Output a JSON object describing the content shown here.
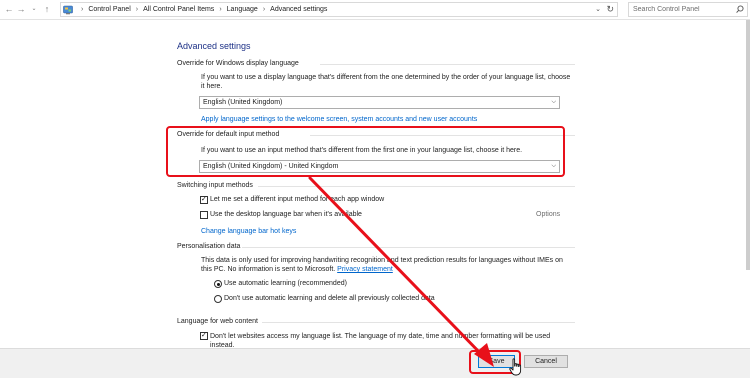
{
  "address_bar": {
    "back_icon": "back-arrow-icon",
    "forward_icon": "forward-arrow-icon",
    "recent_icon": "chevron-down-icon",
    "up_icon": "up-arrow-icon",
    "crumbs": [
      "Control Panel",
      "All Control Panel Items",
      "Language",
      "Advanced settings"
    ],
    "search_placeholder": "Search Control Panel"
  },
  "page": {
    "title": "Advanced settings",
    "display_language": {
      "heading": "Override for Windows display language",
      "desc_line1": "If you want to use a display language that's different from the one determined by the order of your language list, choose",
      "desc_line2": "it here.",
      "selected": "English (United Kingdom)",
      "link": "Apply language settings to the welcome screen, system accounts and new user accounts"
    },
    "input_method": {
      "heading": "Override for default input method",
      "desc": "If you want to use an input method that's different from the first one in your language list, choose it here.",
      "selected": "English (United Kingdom) - United Kingdom"
    },
    "switching": {
      "heading": "Switching input methods",
      "opt1": "Let me set a different input method for each app window",
      "opt1_checked": true,
      "opt2": "Use the desktop language bar when it's available",
      "opt2_checked": false,
      "options_link": "Options",
      "hotkeys_link": "Change language bar hot keys"
    },
    "personalisation": {
      "heading": "Personalisation data",
      "desc_line1": "This data is only used for improving handwriting recognition and text prediction results for languages without IMEs on",
      "desc_line2_text": "this PC. No information is sent to Microsoft.",
      "privacy_link": "Privacy statement",
      "radio1": "Use automatic learning (recommended)",
      "radio1_selected": true,
      "radio2": "Don't use automatic learning and delete all previously collected data",
      "radio2_selected": false
    },
    "web_content": {
      "heading": "Language for web content",
      "opt1_line1": "Don't let websites access my language list. The language of my date, time and number formatting will be used",
      "opt1_line2": "instead.",
      "opt1_checked": true
    }
  },
  "footer": {
    "save_label": "Save",
    "cancel_label": "Cancel"
  },
  "colors": {
    "highlight": "#e8101a",
    "link": "#0066cc",
    "title": "#1e3287"
  }
}
